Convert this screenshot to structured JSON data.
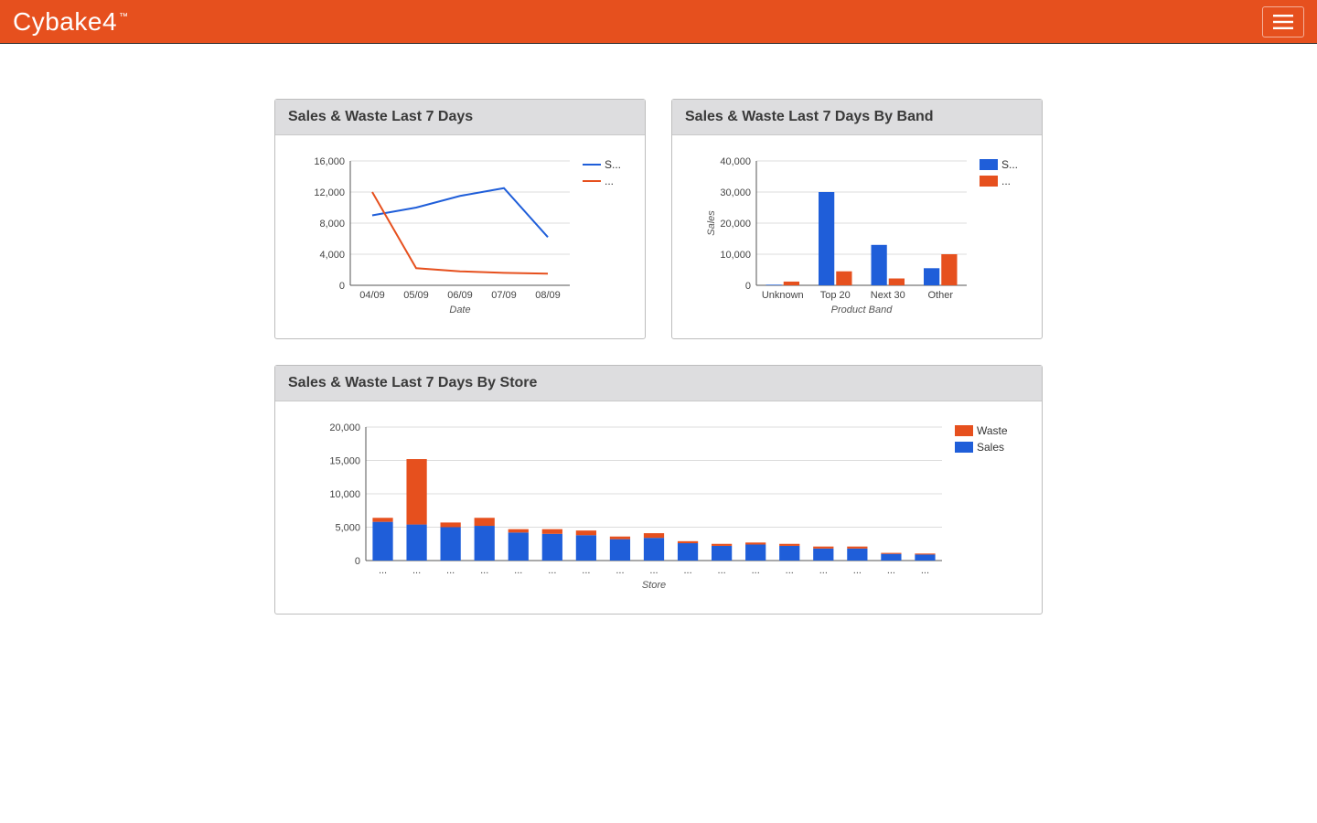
{
  "brand": {
    "name": "Cybake4",
    "tm": "™"
  },
  "colors": {
    "sales": "#1F5ED9",
    "waste": "#E6501E",
    "axis": "#555555",
    "grid": "#dcdcdc",
    "plotBorder": "#bcbcbc"
  },
  "panels": {
    "trend": {
      "title": "Sales & Waste Last 7 Days"
    },
    "band": {
      "title": "Sales & Waste Last 7 Days By Band"
    },
    "store": {
      "title": "Sales & Waste Last 7 Days By Store"
    }
  },
  "chart_data": [
    {
      "id": "trend",
      "type": "line",
      "title": "Sales & Waste Last 7 Days",
      "xlabel": "Date",
      "ylabel": "",
      "categories": [
        "04/09",
        "05/09",
        "06/09",
        "07/09",
        "08/09"
      ],
      "y_ticks": [
        0,
        4000,
        8000,
        12000,
        16000
      ],
      "ylim": [
        0,
        16000
      ],
      "series": [
        {
          "name": "S...",
          "color": "sales",
          "values": [
            9000,
            10000,
            11500,
            12500,
            6200
          ]
        },
        {
          "name": "...",
          "color": "waste",
          "values": [
            12000,
            2200,
            1800,
            1600,
            1500
          ]
        }
      ],
      "legend": {
        "position": "right"
      }
    },
    {
      "id": "band",
      "type": "bar",
      "title": "Sales & Waste Last 7 Days By Band",
      "xlabel": "Product Band",
      "ylabel": "Sales",
      "categories": [
        "Unknown",
        "Top 20",
        "Next 30",
        "Other"
      ],
      "y_ticks": [
        0,
        10000,
        20000,
        30000,
        40000
      ],
      "ylim": [
        0,
        40000
      ],
      "series": [
        {
          "name": "S...",
          "color": "sales",
          "values": [
            200,
            30000,
            13000,
            5500
          ]
        },
        {
          "name": "...",
          "color": "waste",
          "values": [
            1200,
            4500,
            2200,
            10000
          ]
        }
      ],
      "legend": {
        "position": "right"
      }
    },
    {
      "id": "store",
      "type": "bar-stacked",
      "title": "Sales & Waste Last 7 Days By Store",
      "xlabel": "Store",
      "ylabel": "",
      "categories": [
        "...",
        "...",
        "...",
        "...",
        "...",
        "...",
        "...",
        "...",
        "...",
        "...",
        "...",
        "...",
        "...",
        "...",
        "...",
        "...",
        "..."
      ],
      "y_ticks": [
        0,
        5000,
        10000,
        15000,
        20000
      ],
      "ylim": [
        0,
        20000
      ],
      "series": [
        {
          "name": "Sales",
          "color": "sales",
          "values": [
            5800,
            5400,
            5000,
            5200,
            4200,
            4000,
            3800,
            3200,
            3400,
            2600,
            2200,
            2400,
            2200,
            1800,
            1800,
            1000,
            900
          ]
        },
        {
          "name": "Waste",
          "color": "waste",
          "values": [
            600,
            9800,
            700,
            1200,
            500,
            700,
            700,
            400,
            700,
            300,
            300,
            300,
            300,
            300,
            300,
            150,
            150
          ]
        }
      ],
      "legend": {
        "position": "right",
        "order": [
          "Waste",
          "Sales"
        ]
      }
    }
  ]
}
